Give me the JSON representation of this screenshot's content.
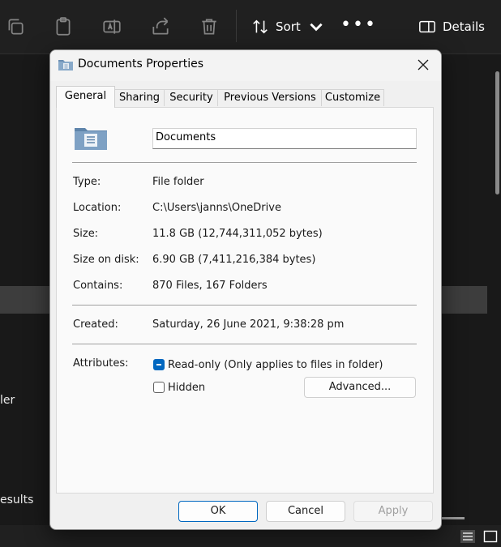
{
  "explorer": {
    "toolbar": {
      "sort_label": "Sort",
      "details_label": "Details"
    },
    "background_text": {
      "item_fragment": "ler",
      "results_fragment": "esults"
    }
  },
  "dialog": {
    "title": "Documents Properties",
    "tabs": [
      {
        "label": "General",
        "active": true
      },
      {
        "label": "Sharing",
        "active": false
      },
      {
        "label": "Security",
        "active": false
      },
      {
        "label": "Previous Versions",
        "active": false
      },
      {
        "label": "Customize",
        "active": false
      }
    ],
    "folder_name": "Documents",
    "properties": {
      "type": {
        "label": "Type:",
        "value": "File folder"
      },
      "location": {
        "label": "Location:",
        "value": "C:\\Users\\janns\\OneDrive"
      },
      "size": {
        "label": "Size:",
        "value": "11.8 GB (12,744,311,052 bytes)"
      },
      "size_on_disk": {
        "label": "Size on disk:",
        "value": "6.90 GB (7,411,216,384 bytes)"
      },
      "contains": {
        "label": "Contains:",
        "value": "870 Files, 167 Folders"
      },
      "created": {
        "label": "Created:",
        "value": "Saturday, 26 June 2021, 9:38:28 pm"
      }
    },
    "attributes": {
      "label": "Attributes:",
      "readonly_label": "Read-only (Only applies to files in folder)",
      "readonly_state": "indeterminate",
      "hidden_label": "Hidden",
      "hidden_state": "unchecked",
      "advanced_label": "Advanced..."
    },
    "buttons": {
      "ok": "OK",
      "cancel": "Cancel",
      "apply": "Apply"
    }
  },
  "colors": {
    "accent": "#0067c0",
    "explorer_bg": "#191919",
    "dialog_bg": "#f0f0f0"
  }
}
